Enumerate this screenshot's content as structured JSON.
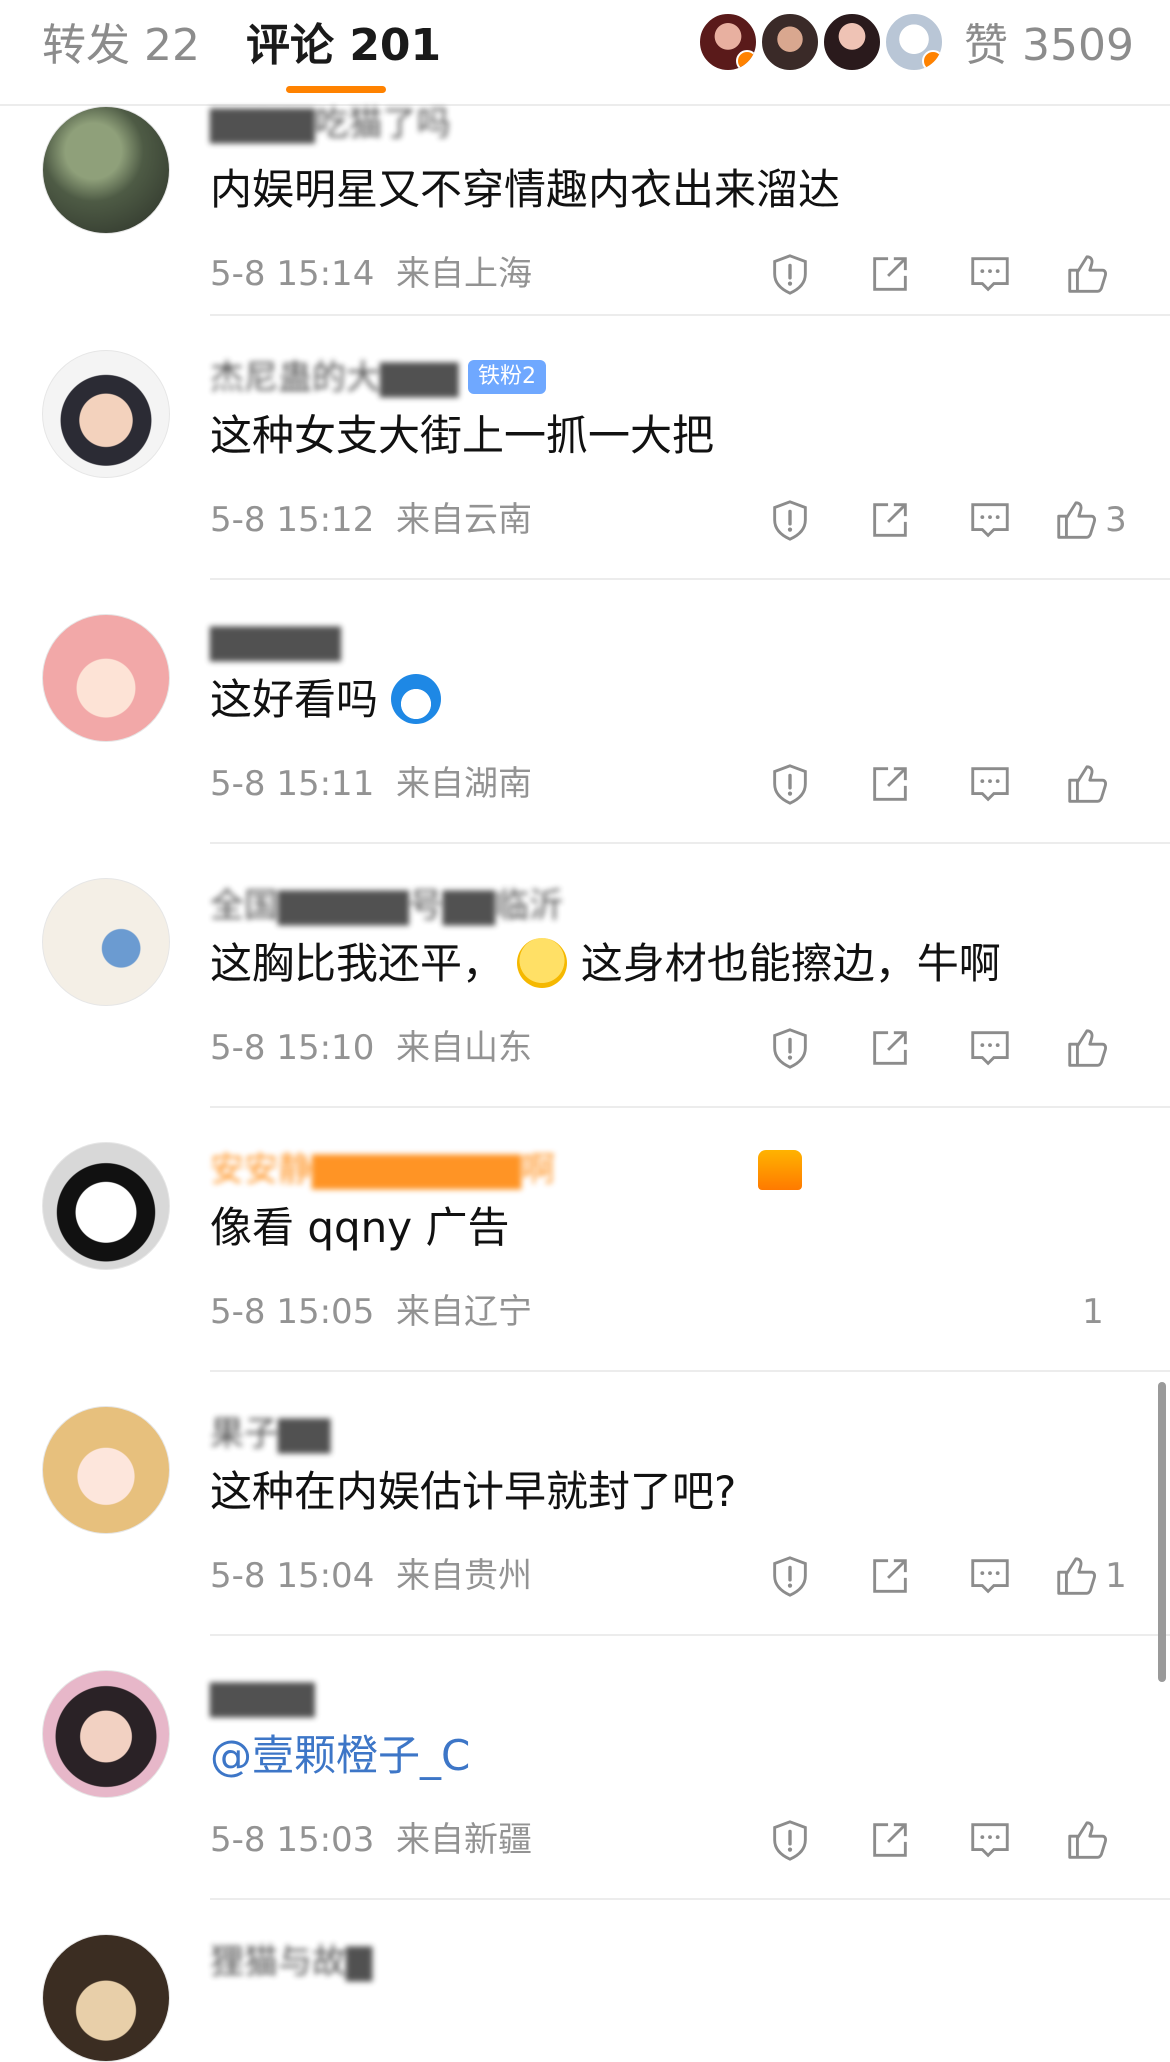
{
  "header": {
    "repost_tab": "转发 22",
    "comments_tab": "评论 201",
    "likes_total": "赞 3509",
    "accent": "#ff8200"
  },
  "comments": [
    {
      "username": "▇▇▇▇吃猫了吗",
      "text": "内娱明星又不穿情趣内衣出来溜达",
      "time": "5-8 15:14",
      "location": "来自上海",
      "likes": ""
    },
    {
      "username": "杰尼蛊的大▇▇▇",
      "badge": "铁粉2",
      "text": "这种女支大街上一抓一大把",
      "time": "5-8 15:12",
      "location": "来自云南",
      "likes": "3"
    },
    {
      "username": "▇▇▇▇▇",
      "text": "这好看吗",
      "time": "5-8 15:11",
      "location": "来自湖南",
      "likes": ""
    },
    {
      "username": "全国▇▇▇▇▇号▇▇临沂",
      "text_before": "这胸比我还平，",
      "text_after": "这身材也能擦边，牛啊",
      "time": "5-8 15:10",
      "location": "来自山东",
      "likes": ""
    },
    {
      "username": "安安静▇▇▇▇▇▇▇▇啊",
      "text": "像看 qqny 广告",
      "time": "5-8 15:05",
      "location": "来自辽宁",
      "likes": "1"
    },
    {
      "username": "果子▇▇",
      "text": "这种在内娱估计早就封了吧?",
      "time": "5-8 15:04",
      "location": "来自贵州",
      "likes": "1"
    },
    {
      "username": "▇▇▇▇",
      "text": "@壹颗橙子_C",
      "time": "5-8 15:03",
      "location": "来自新疆",
      "likes": ""
    },
    {
      "username": "狸猫与故▇"
    }
  ]
}
